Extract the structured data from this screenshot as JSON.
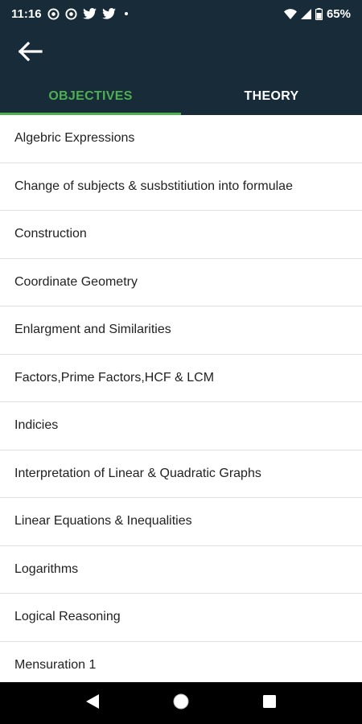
{
  "status_bar": {
    "time": "11:16",
    "battery": "65%",
    "left_icons": [
      "notification-icon",
      "notification-icon",
      "twitter-icon",
      "twitter-icon",
      "more-dot-icon"
    ],
    "right_icons": [
      "wifi-icon",
      "signal-icon",
      "battery-icon"
    ]
  },
  "app_bar": {
    "back_icon": "arrow-back-icon"
  },
  "tabs": [
    {
      "label": "OBJECTIVES",
      "active": true
    },
    {
      "label": "THEORY",
      "active": false
    }
  ],
  "topics": [
    "Algebric Expressions",
    "Change of subjects & susbstitiution into formulae",
    "Construction",
    "Coordinate Geometry",
    "Enlargment and Similarities",
    "Factors,Prime Factors,HCF & LCM",
    "Indicies",
    "Interpretation of Linear & Quadratic Graphs",
    "Linear Equations & Inequalities",
    "Logarithms",
    "Logical Reasoning",
    "Mensuration 1"
  ],
  "nav_bar": {
    "buttons": [
      "back-triangle-icon",
      "home-circle-icon",
      "recents-square-icon"
    ]
  },
  "colors": {
    "header_bg": "#172b39",
    "accent": "#4caf50",
    "text": "#222222",
    "divider": "#e0e0e0"
  }
}
